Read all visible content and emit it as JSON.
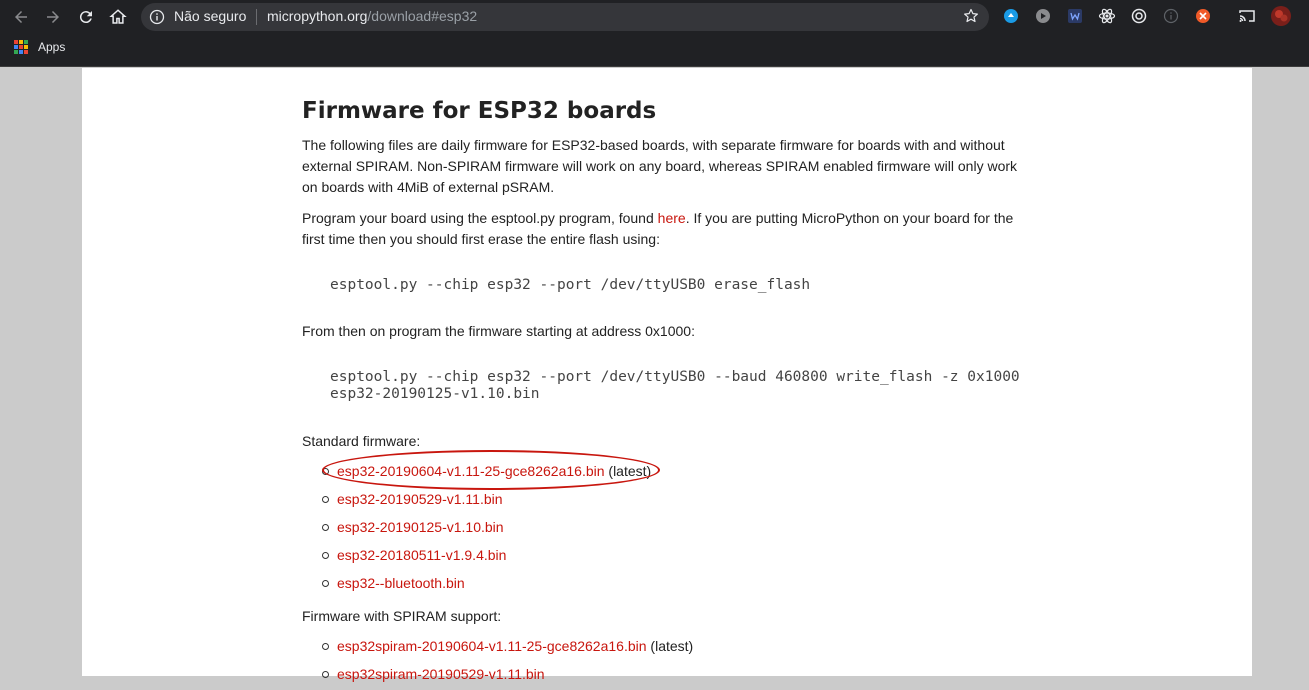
{
  "browser": {
    "security_label": "Não seguro",
    "url_domain": "micropython.org",
    "url_path": "/download#esp32",
    "bookmarks": {
      "apps_label": "Apps"
    },
    "icons": [
      "back-arrow-icon",
      "forward-arrow-icon",
      "reload-icon",
      "home-icon",
      "info-icon",
      "star-icon",
      "cast-icon",
      "profile-avatar-icon"
    ]
  },
  "page": {
    "title": "Firmware for ESP32 boards",
    "intro": "The following files are daily firmware for ESP32-based boards, with separate firmware for boards with and without external SPIRAM. Non-SPIRAM firmware will work on any board, whereas SPIRAM enabled firmware will only work on boards with 4MiB of external pSRAM.",
    "program_text_before": "Program your board using the esptool.py program, found ",
    "program_link": "here",
    "program_text_after": ". If you are putting MicroPython on your board for the first time then you should first erase the entire flash using:",
    "erase_cmd": "esptool.py --chip esp32 --port /dev/ttyUSB0 erase_flash",
    "from_then": "From then on program the firmware starting at address 0x1000:",
    "write_cmd_line1": "esptool.py --chip esp32 --port /dev/ttyUSB0 --baud 460800 write_flash -z 0x1000",
    "write_cmd_line2": "esp32-20190125-v1.10.bin",
    "standard_label": "Standard firmware:",
    "standard_files": [
      {
        "name": "esp32-20190604-v1.11-25-gce8262a16.bin",
        "suffix": " (latest)"
      },
      {
        "name": "esp32-20190529-v1.11.bin",
        "suffix": ""
      },
      {
        "name": "esp32-20190125-v1.10.bin",
        "suffix": ""
      },
      {
        "name": "esp32-20180511-v1.9.4.bin",
        "suffix": ""
      },
      {
        "name": "esp32--bluetooth.bin",
        "suffix": ""
      }
    ],
    "spiram_label": "Firmware with SPIRAM support:",
    "spiram_files": [
      {
        "name": "esp32spiram-20190604-v1.11-25-gce8262a16.bin",
        "suffix": " (latest)"
      },
      {
        "name": "esp32spiram-20190529-v1.11.bin",
        "suffix": ""
      }
    ]
  },
  "colors": {
    "link": "#c8160e",
    "chrome": "#202124",
    "annotation": "#c8160e"
  }
}
